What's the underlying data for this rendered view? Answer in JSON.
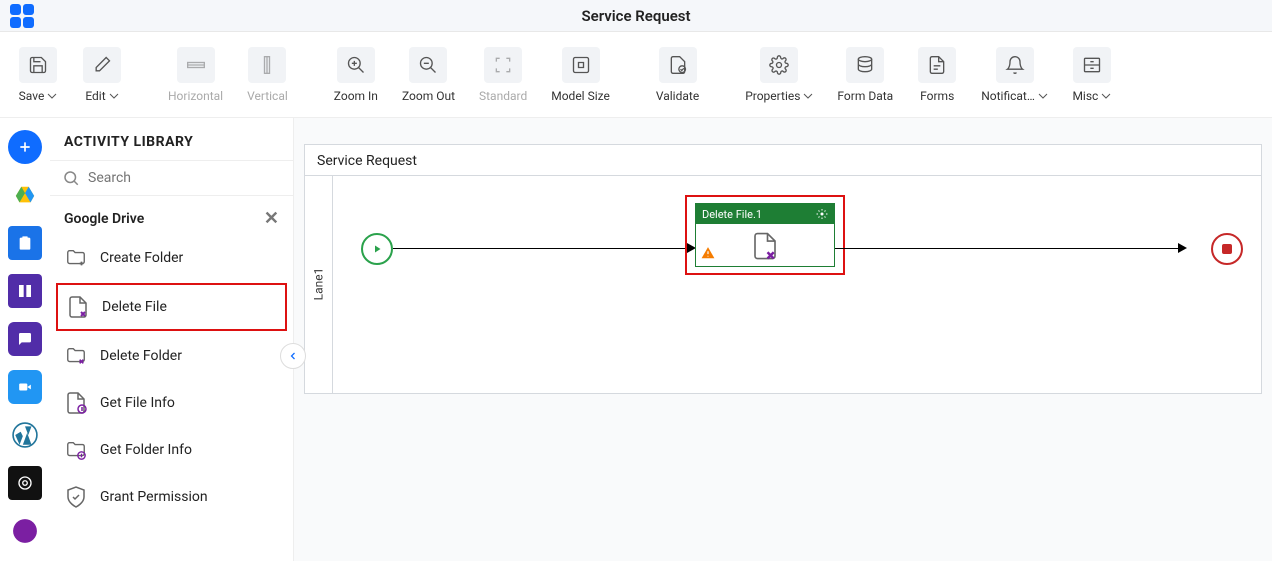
{
  "header": {
    "title": "Service Request"
  },
  "toolbar": {
    "save": "Save",
    "edit": "Edit",
    "horizontal": "Horizontal",
    "vertical": "Vertical",
    "zoomin": "Zoom In",
    "zoomout": "Zoom Out",
    "standard": "Standard",
    "modelsize": "Model Size",
    "validate": "Validate",
    "properties": "Properties",
    "formdata": "Form Data",
    "forms": "Forms",
    "notifications": "Notificat…",
    "misc": "Misc"
  },
  "sidebar": {
    "title": "ACTIVITY LIBRARY",
    "search_placeholder": "Search",
    "group": "Google Drive",
    "items": [
      {
        "label": "Create Folder"
      },
      {
        "label": "Delete File"
      },
      {
        "label": "Delete Folder"
      },
      {
        "label": "Get File Info"
      },
      {
        "label": "Get Folder Info"
      },
      {
        "label": "Grant Permission"
      }
    ]
  },
  "canvas": {
    "title": "Service Request",
    "lane": "Lane1",
    "node_title": "Delete File.1"
  }
}
